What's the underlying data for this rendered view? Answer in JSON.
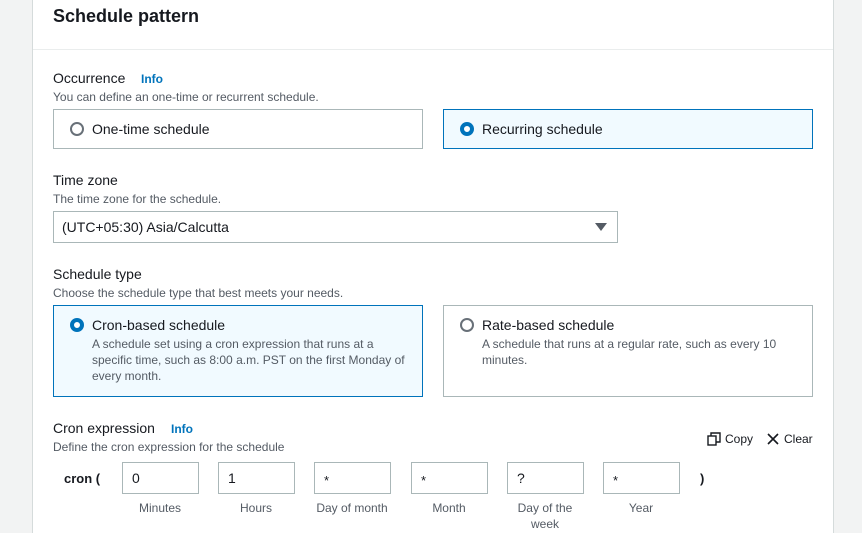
{
  "panel": {
    "title": "Schedule pattern"
  },
  "occurrence": {
    "label": "Occurrence",
    "info": "Info",
    "description": "You can define an one-time or recurrent schedule.",
    "options": [
      {
        "label": "One-time schedule",
        "selected": false
      },
      {
        "label": "Recurring schedule",
        "selected": true
      }
    ]
  },
  "timezone": {
    "label": "Time zone",
    "description": "The time zone for the schedule.",
    "value": "(UTC+05:30) Asia/Calcutta"
  },
  "schedule_type": {
    "label": "Schedule type",
    "description": "Choose the schedule type that best meets your needs.",
    "options": [
      {
        "label": "Cron-based schedule",
        "description": "A schedule set using a cron expression that runs at a specific time, such as 8:00 a.m. PST on the first Monday of every month.",
        "selected": true
      },
      {
        "label": "Rate-based schedule",
        "description": "A schedule that runs at a regular rate, such as every 10 minutes.",
        "selected": false
      }
    ]
  },
  "cron": {
    "label": "Cron expression",
    "info": "Info",
    "description": "Define the cron expression for the schedule",
    "copy_label": "Copy",
    "clear_label": "Clear",
    "prefix": "cron (",
    "suffix": ")",
    "fields": [
      {
        "caption": "Minutes",
        "value": "0"
      },
      {
        "caption": "Hours",
        "value": "1"
      },
      {
        "caption": "Day of month",
        "value": "*"
      },
      {
        "caption": "Month",
        "value": "*"
      },
      {
        "caption": "Day of the week",
        "value": "?"
      },
      {
        "caption": "Year",
        "value": "*"
      }
    ]
  },
  "colors": {
    "accent": "#0073bb",
    "selected_bg": "#f1faff",
    "border": "#aab7b8"
  },
  "icons": {
    "copy": "copy-icon",
    "clear": "close-icon",
    "dropdown": "caret-down-icon"
  }
}
